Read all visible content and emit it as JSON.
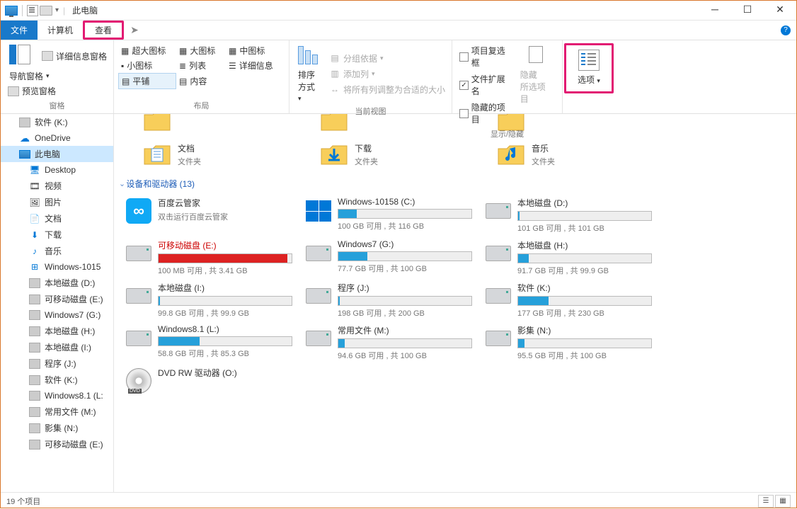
{
  "window": {
    "title": "此电脑"
  },
  "tabs": {
    "file": "文件",
    "computer": "计算机",
    "view": "查看"
  },
  "ribbon": {
    "panes": {
      "nav": "导航窗格",
      "preview": "预览窗格",
      "details": "详细信息窗格",
      "group": "窗格"
    },
    "layout": {
      "xlarge": "超大图标",
      "large": "大图标",
      "medium": "中图标",
      "small": "小图标",
      "list": "列表",
      "details": "详细信息",
      "tiles": "平铺",
      "content": "内容",
      "group": "布局"
    },
    "currentview": {
      "sort": "排序方式",
      "groupby": "分组依据",
      "addcols": "添加列",
      "fitcols": "将所有列调整为合适的大小",
      "group": "当前视图"
    },
    "showhide": {
      "checkboxes": "项目复选框",
      "extensions": "文件扩展名",
      "hidden": "隐藏的项目",
      "selected": "所选项目",
      "hide": "隐藏",
      "group": "显示/隐藏"
    },
    "options": "选项"
  },
  "sidebar": [
    {
      "icon": "drive",
      "label": "软件 (K:)"
    },
    {
      "icon": "onedrive",
      "label": "OneDrive"
    },
    {
      "icon": "thispc",
      "label": "此电脑",
      "selected": true
    },
    {
      "icon": "desktop",
      "label": "Desktop",
      "lvl": 2
    },
    {
      "icon": "video",
      "label": "视频",
      "lvl": 2
    },
    {
      "icon": "pictures",
      "label": "图片",
      "lvl": 2
    },
    {
      "icon": "docs",
      "label": "文档",
      "lvl": 2
    },
    {
      "icon": "downloads",
      "label": "下载",
      "lvl": 2
    },
    {
      "icon": "music",
      "label": "音乐",
      "lvl": 2
    },
    {
      "icon": "windrive",
      "label": "Windows-1015",
      "lvl": 2
    },
    {
      "icon": "drive",
      "label": "本地磁盘 (D:)",
      "lvl": 2
    },
    {
      "icon": "drive",
      "label": "可移动磁盘 (E:)",
      "lvl": 2
    },
    {
      "icon": "drive",
      "label": "Windows7 (G:)",
      "lvl": 2
    },
    {
      "icon": "drive",
      "label": "本地磁盘 (H:)",
      "lvl": 2
    },
    {
      "icon": "drive",
      "label": "本地磁盘 (I:)",
      "lvl": 2
    },
    {
      "icon": "drive",
      "label": "程序 (J:)",
      "lvl": 2
    },
    {
      "icon": "drive",
      "label": "软件 (K:)",
      "lvl": 2
    },
    {
      "icon": "drive",
      "label": "Windows8.1 (L:",
      "lvl": 2
    },
    {
      "icon": "drive",
      "label": "常用文件 (M:)",
      "lvl": 2
    },
    {
      "icon": "drive",
      "label": "影集 (N:)",
      "lvl": 2
    },
    {
      "icon": "drive",
      "label": "可移动磁盘 (E:)",
      "lvl": 2
    }
  ],
  "folders": {
    "top": [
      {
        "name": "文档",
        "sub": "文件夹",
        "type": "docs"
      },
      {
        "name": "下载",
        "sub": "文件夹",
        "type": "downloads"
      },
      {
        "name": "音乐",
        "sub": "文件夹",
        "type": "music"
      }
    ]
  },
  "section_header": "设备和驱动器 (13)",
  "drives": [
    {
      "name": "百度云管家",
      "sub": "双击运行百度云管家",
      "type": "baidu",
      "nobar": true
    },
    {
      "name": "Windows-10158 (C:)",
      "stat": "100 GB 可用 , 共 116 GB",
      "type": "win",
      "fill": 14,
      "color": "#26a0da"
    },
    {
      "name": "本地磁盘 (D:)",
      "stat": "101 GB 可用 , 共 101 GB",
      "type": "hdd",
      "fill": 1,
      "color": "#26a0da"
    },
    {
      "name": "可移动磁盘 (E:)",
      "stat": "100 MB 可用 , 共 3.41 GB",
      "type": "hdd",
      "fill": 97,
      "color": "#d22",
      "namecolor": "#c00"
    },
    {
      "name": "Windows7 (G:)",
      "stat": "77.7 GB 可用 , 共 100 GB",
      "type": "hdd",
      "fill": 22,
      "color": "#26a0da"
    },
    {
      "name": "本地磁盘 (H:)",
      "stat": "91.7 GB 可用 , 共 99.9 GB",
      "type": "hdd",
      "fill": 8,
      "color": "#26a0da"
    },
    {
      "name": "本地磁盘 (I:)",
      "stat": "99.8 GB 可用 , 共 99.9 GB",
      "type": "hdd",
      "fill": 1,
      "color": "#26a0da"
    },
    {
      "name": "程序 (J:)",
      "stat": "198 GB 可用 , 共 200 GB",
      "type": "hdd",
      "fill": 1,
      "color": "#26a0da"
    },
    {
      "name": "软件 (K:)",
      "stat": "177 GB 可用 , 共 230 GB",
      "type": "hdd",
      "fill": 23,
      "color": "#26a0da"
    },
    {
      "name": "Windows8.1 (L:)",
      "stat": "58.8 GB 可用 , 共 85.3 GB",
      "type": "hdd",
      "fill": 31,
      "color": "#26a0da"
    },
    {
      "name": "常用文件 (M:)",
      "stat": "94.6 GB 可用 , 共 100 GB",
      "type": "hdd",
      "fill": 5,
      "color": "#26a0da"
    },
    {
      "name": "影集 (N:)",
      "stat": "95.5 GB 可用 , 共 100 GB",
      "type": "hdd",
      "fill": 5,
      "color": "#26a0da"
    },
    {
      "name": "DVD RW 驱动器 (O:)",
      "type": "dvd",
      "nobar": true
    }
  ],
  "status": "19 个项目"
}
